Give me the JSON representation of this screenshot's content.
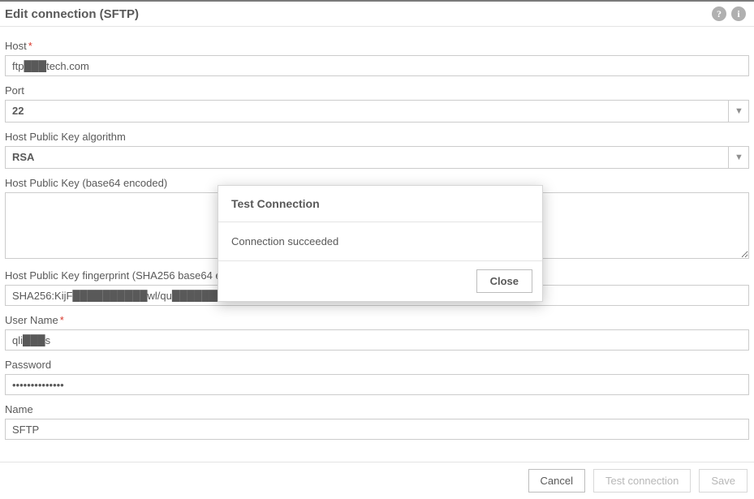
{
  "header": {
    "title": "Edit connection (SFTP)",
    "help_icon": "?",
    "info_icon": "i"
  },
  "fields": {
    "host": {
      "label": "Host",
      "required": true,
      "value": "ftp███tech.com"
    },
    "port": {
      "label": "Port",
      "required": false,
      "value": "22"
    },
    "algo": {
      "label": "Host Public Key algorithm",
      "required": false,
      "value": "RSA"
    },
    "pubkey": {
      "label": "Host Public Key (base64 encoded)",
      "required": false,
      "value": ""
    },
    "fingerprint": {
      "label": "Host Public Key fingerprint (SHA256 base64 encoded)",
      "required": false,
      "value": "SHA256:KijF██████████wl/qu████████████Wjo"
    },
    "username": {
      "label": "User Name",
      "required": true,
      "value": "qli███s"
    },
    "password": {
      "label": "Password",
      "required": false,
      "value": "••••••••••••••"
    },
    "name": {
      "label": "Name",
      "required": false,
      "value": "SFTP"
    }
  },
  "footer": {
    "cancel": "Cancel",
    "test": "Test connection",
    "save": "Save"
  },
  "modal": {
    "title": "Test Connection",
    "message": "Connection succeeded",
    "close": "Close"
  }
}
